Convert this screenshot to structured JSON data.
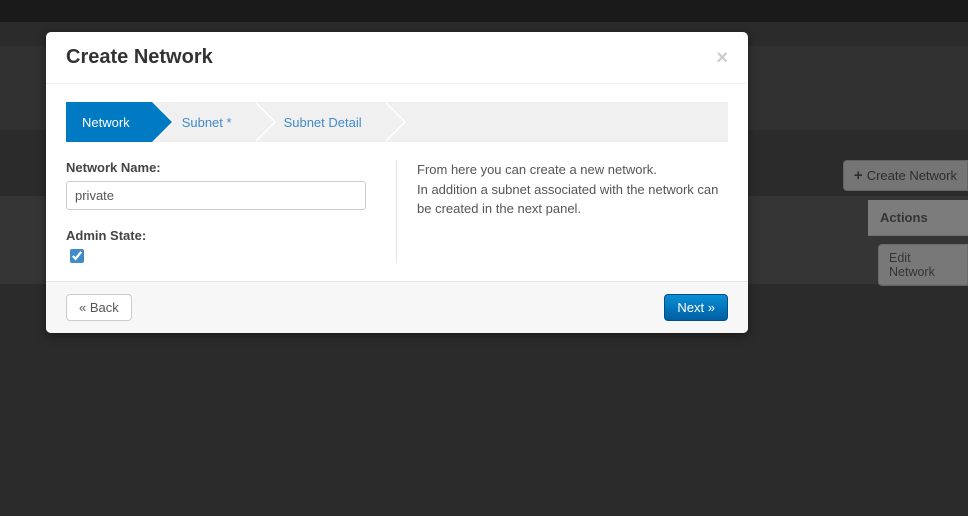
{
  "background": {
    "create_button_label": "Create Network",
    "actions_header": "Actions",
    "edit_button_label": "Edit Network"
  },
  "modal": {
    "title": "Create Network",
    "close_label": "×",
    "steps": {
      "network": "Network",
      "subnet": "Subnet *",
      "subnet_detail": "Subnet Detail"
    },
    "form": {
      "network_name_label": "Network Name:",
      "network_name_value": "private",
      "admin_state_label": "Admin State:",
      "admin_state_checked": true
    },
    "help": {
      "line1": "From here you can create a new network.",
      "line2": "In addition a subnet associated with the network can be created in the next panel."
    },
    "footer": {
      "back_label": "« Back",
      "next_label": "Next »"
    }
  }
}
